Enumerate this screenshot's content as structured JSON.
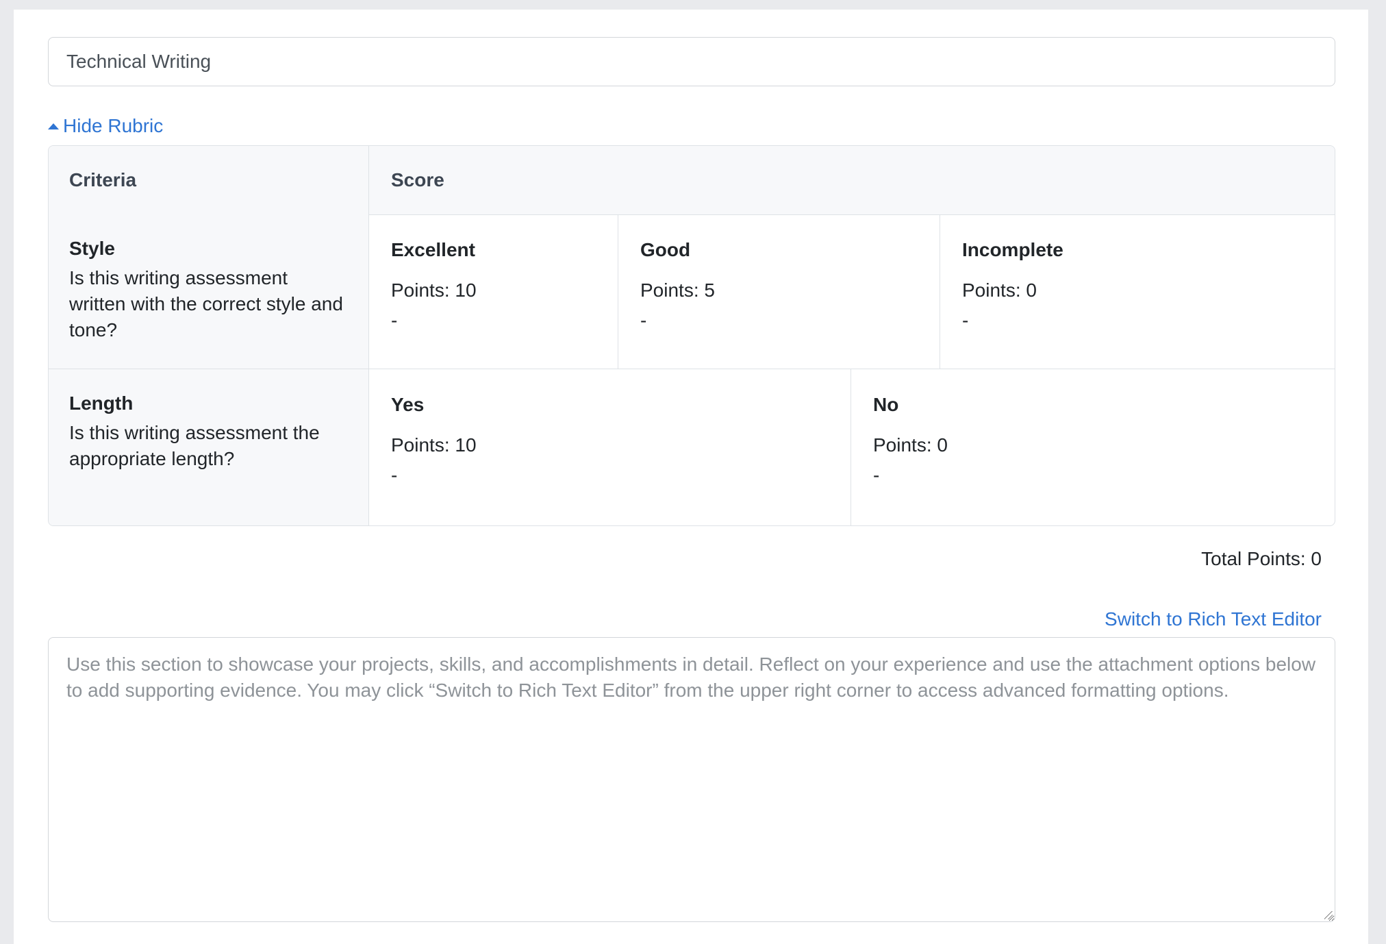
{
  "assessment": {
    "title_value": "Technical Writing"
  },
  "rubric": {
    "toggle_label": "Hide Rubric",
    "header": {
      "criteria": "Criteria",
      "score": "Score"
    },
    "criteria": [
      {
        "name": "Style",
        "description": "Is this writing assessment written with the correct style and tone?",
        "levels": [
          {
            "name": "Excellent",
            "points": "Points: 10",
            "description": "-"
          },
          {
            "name": "Good",
            "points": "Points: 5",
            "description": "-"
          },
          {
            "name": "Incomplete",
            "points": "Points: 0",
            "description": "-"
          }
        ]
      },
      {
        "name": "Length",
        "description": "Is this writing assessment the appropriate length?",
        "levels": [
          {
            "name": "Yes",
            "points": "Points: 10",
            "description": "-"
          },
          {
            "name": "No",
            "points": "Points: 0",
            "description": "-"
          }
        ]
      }
    ],
    "total_label": "Total Points: 0"
  },
  "editor": {
    "switch_label": "Switch to Rich Text Editor",
    "placeholder": "Use this section to showcase your projects, skills, and accomplishments in detail. Reflect on your experience and use the attachment options below to add supporting evidence. You may click “Switch to Rich Text Editor” from the upper right corner to access advanced formatting options."
  },
  "colors": {
    "link": "#2f75d3",
    "border": "#dee2e6",
    "header_bg": "#f7f8fa"
  }
}
